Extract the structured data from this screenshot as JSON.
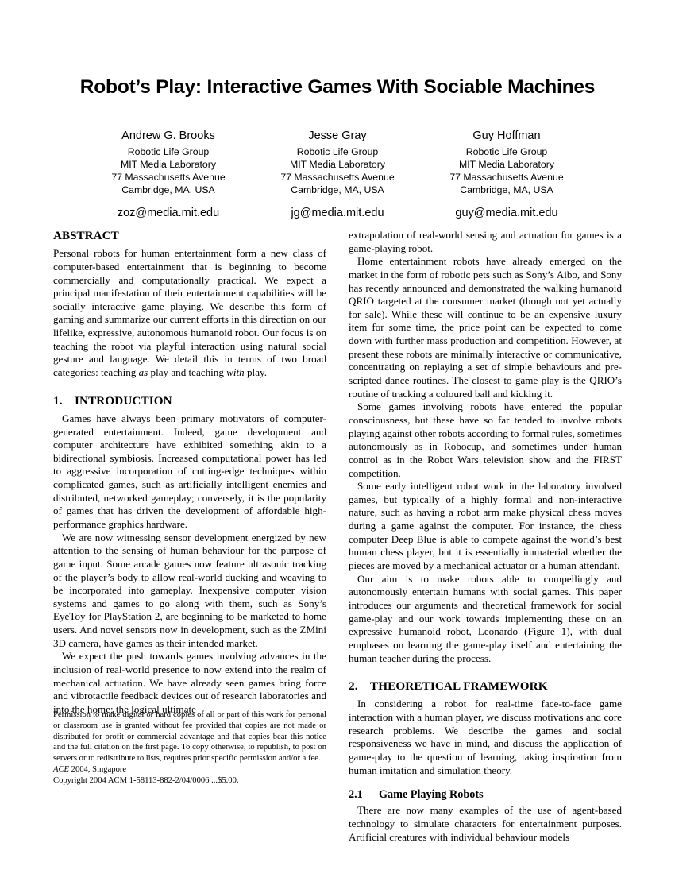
{
  "paper": {
    "title": "Robot’s Play: Interactive Games With Sociable Machines",
    "authors": [
      {
        "name": "Andrew G. Brooks",
        "group": "Robotic Life Group",
        "institution": "MIT Media Laboratory",
        "street": "77 Massachusetts Avenue",
        "city": "Cambridge, MA, USA",
        "email": "zoz@media.mit.edu"
      },
      {
        "name": "Jesse Gray",
        "group": "Robotic Life Group",
        "institution": "MIT Media Laboratory",
        "street": "77 Massachusetts Avenue",
        "city": "Cambridge, MA, USA",
        "email": "jg@media.mit.edu"
      },
      {
        "name": "Guy Hoffman",
        "group": "Robotic Life Group",
        "institution": "MIT Media Laboratory",
        "street": "77 Massachusetts Avenue",
        "city": "Cambridge, MA, USA",
        "email": "guy@media.mit.edu"
      }
    ],
    "abstract": {
      "heading": "ABSTRACT",
      "text_part1": "Personal robots for human entertainment form a new class of computer-based entertainment that is beginning to become commercially and computationally practical. We expect a principal manifestation of their entertainment capabilities will be socially interactive game playing. We describe this form of gaming and summarize our current efforts in this direction on our lifelike, expressive, autonomous humanoid robot. Our focus is on teaching the robot via playful interaction using natural social gesture and language. We detail this in terms of two broad categories: teaching ",
      "italic1": "as",
      "text_part2": " play and teaching ",
      "italic2": "with",
      "text_part3": " play."
    },
    "sections": {
      "introduction": {
        "number": "1.",
        "title": "INTRODUCTION",
        "paragraphs": [
          "Games have always been primary motivators of computer-generated entertainment. Indeed, game development and computer architecture have exhibited something akin to a bidirectional symbiosis. Increased computational power has led to aggressive incorporation of cutting-edge techniques within complicated games, such as artificially intelligent enemies and distributed, networked gameplay; conversely, it is the popularity of games that has driven the development of affordable high-performance graphics hardware.",
          "We are now witnessing sensor development energized by new attention to the sensing of human behaviour for the purpose of game input. Some arcade games now feature ultrasonic tracking of the player’s body to allow real-world ducking and weaving to be incorporated into gameplay. Inexpensive computer vision systems and games to go along with them, such as Sony’s EyeToy for PlayStation 2, are beginning to be marketed to home users. And novel sensors now in development, such as the ZMini 3D camera, have games as their intended market.",
          "We expect the push towards games involving advances in the inclusion of real-world presence to now extend into the realm of mechanical actuation. We have already seen games bring force and vibrotactile feedback devices out of research laboratories and into the home; the logical ultimate",
          "extrapolation of real-world sensing and actuation for games is a game-playing robot.",
          "Home entertainment robots have already emerged on the market in the form of robotic pets such as Sony’s Aibo, and Sony has recently announced and demonstrated the walking humanoid QRIO targeted at the consumer market (though not yet actually for sale). While these will continue to be an expensive luxury item for some time, the price point can be expected to come down with further mass production and competition. However, at present these robots are minimally interactive or communicative, concentrating on replaying a set of simple behaviours and pre-scripted dance routines. The closest to game play is the QRIO’s routine of tracking a coloured ball and kicking it.",
          "Some games involving robots have entered the popular consciousness, but these have so far tended to involve robots playing against other robots according to formal rules, sometimes autonomously as in Robocup, and sometimes under human control as in the Robot Wars television show and the FIRST competition.",
          "Some early intelligent robot work in the laboratory involved games, but typically of a highly formal and non-interactive nature, such as having a robot arm make physical chess moves during a game against the computer. For instance, the chess computer Deep Blue is able to compete against the world’s best human chess player, but it is essentially immaterial whether the pieces are moved by a mechanical actuator or a human attendant.",
          "Our aim is to make robots able to compellingly and autonomously entertain humans with social games. This paper introduces our arguments and theoretical framework for social game-play and our work towards implementing these on an expressive humanoid robot, Leonardo (Figure 1), with dual emphases on learning the game-play itself and entertaining the human teacher during the process."
        ]
      },
      "theoretical_framework": {
        "number": "2.",
        "title": "THEORETICAL FRAMEWORK",
        "paragraph": "In considering a robot for real-time face-to-face game interaction with a human player, we discuss motivations and core research problems. We describe the games and social responsiveness we have in mind, and discuss the application of game-play to the question of learning, taking inspiration from human imitation and simulation theory.",
        "subsection": {
          "number": "2.1",
          "title": "Game Playing Robots",
          "paragraph": "There are now many examples of the use of agent-based technology to simulate characters for entertainment purposes. Artificial creatures with individual behaviour models"
        }
      }
    },
    "copyright": {
      "permission": "Permission to make digital or hard copies of all or part of this work for personal or classroom use is granted without fee provided that copies are not made or distributed for profit or commercial advantage and that copies bear this notice and the full citation on the first page. To copy otherwise, to republish, to post on servers or to redistribute to lists, requires prior specific permission and/or a fee.",
      "conference_italic": "ACE",
      "conference_rest": " 2004, Singapore",
      "line": "Copyright 2004 ACM 1-58113-882-2/04/0006 ...$5.00."
    }
  }
}
